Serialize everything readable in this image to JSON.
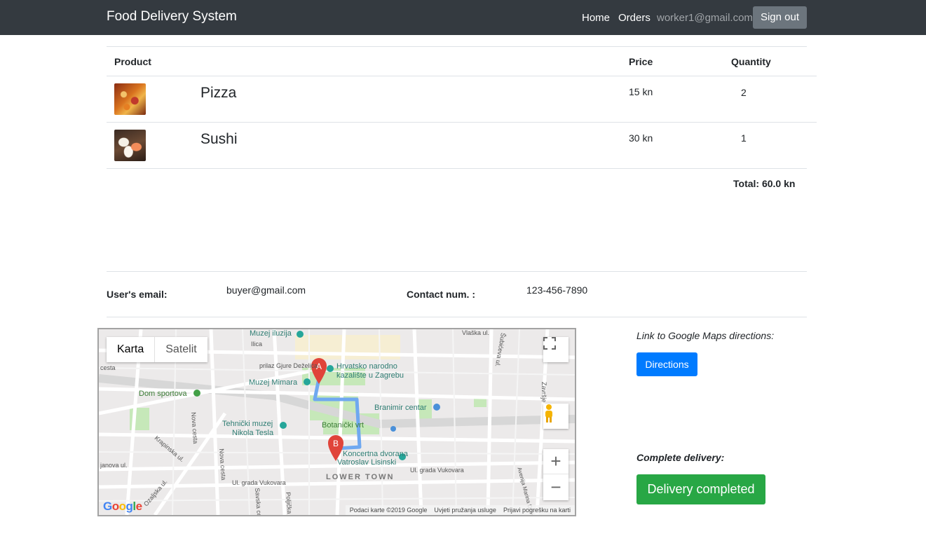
{
  "navbar": {
    "brand": "Food Delivery System",
    "links": [
      "Home",
      "Orders"
    ],
    "user_email": "worker1@gmail.com",
    "sign_out": "Sign out"
  },
  "table": {
    "headers": {
      "product": "Product",
      "price": "Price",
      "quantity": "Quantity"
    },
    "rows": [
      {
        "name": "Pizza",
        "price": "15 kn",
        "quantity": "2",
        "image": "pizza-image"
      },
      {
        "name": "Sushi",
        "price": "30 kn",
        "quantity": "1",
        "image": "sushi-image"
      }
    ],
    "total": "Total: 60.0 kn"
  },
  "user": {
    "email_label": "User's email:",
    "email": "buyer@gmail.com",
    "contact_label": "Contact num. :",
    "contact": "123-456-7890"
  },
  "map": {
    "tabs": [
      "Karta",
      "Satelit"
    ],
    "active_tab": "Karta",
    "zoom_in": "+",
    "zoom_out": "−",
    "labels": {
      "muzej_iluzija": "Muzej iluzija",
      "vlaska": "Vlaška ul.",
      "ilica": "Ilica",
      "prilaz": "prilaz Gjure Deželića",
      "hnk": "Hrvatsko narodno",
      "hnk2": "kazalište u Zagrebu",
      "mimara": "Muzej Mimara",
      "dom": "Dom sportova",
      "branimir": "Branimir centar",
      "tehnicki": "Tehnički muzej",
      "tesla": "Nikola Tesla",
      "botanicki": "Botanički vrt",
      "lisinski": "Koncertna dvorana",
      "lisinski2": "Vatroslav Lisinski",
      "lower": "LOWER TOWN",
      "vukovara": "Ul. grada Vukovara",
      "vukovara2": "Ul. grada Vukovara",
      "nova_cesta": "Nova cesta",
      "nova_cesta2": "Nova cesta",
      "krapinska": "Krapinska ul.",
      "ozaljska": "Ozaljska ul.",
      "janova": "janova ul.",
      "cesta": "cesta",
      "savska": "Savska cesta",
      "poljicka": "Poljička",
      "subiceva": "Šubićeva ul.",
      "zavrtnica": "Završje",
      "drziceva": "Avenija Marina Držića"
    },
    "markers": [
      "A",
      "B"
    ],
    "attribution": [
      "Podaci karte ©2019 Google",
      "Uvjeti pružanja usluge",
      "Prijavi pogrešku na karti"
    ],
    "logo": "Google",
    "colors": {
      "route": "#6fa8f0",
      "marker": "#e0443a",
      "park": "#c6e8b9",
      "road": "#ffffff",
      "water": "#aadaff"
    }
  },
  "actions": {
    "link_label": "Link to Google Maps directions:",
    "directions": "Directions",
    "complete_label": "Complete delivery:",
    "complete_button": "Delivery completed"
  },
  "colors": {
    "navbar_bg": "#343a40",
    "primary": "#007bff",
    "success": "#28a745",
    "secondary": "#6c757d"
  }
}
